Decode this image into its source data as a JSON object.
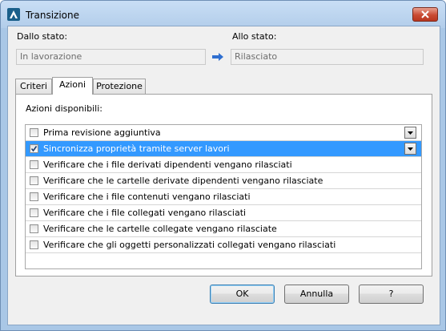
{
  "window": {
    "title": "Transizione",
    "app_icon": "app-logo-icon",
    "close_icon": "close-icon"
  },
  "from_state": {
    "label": "Dallo stato:",
    "value": "In lavorazione"
  },
  "to_state": {
    "label": "Allo stato:",
    "value": "Rilasciato"
  },
  "arrow_icon": "arrow-right-icon",
  "tabs": [
    {
      "label": "Criteri",
      "active": false
    },
    {
      "label": "Azioni",
      "active": true
    },
    {
      "label": "Protezione",
      "active": false
    }
  ],
  "actions": {
    "heading": "Azioni disponibili:",
    "items": [
      {
        "label": "Prima revisione aggiuntiva",
        "checked": false,
        "selected": false,
        "has_dropdown": true
      },
      {
        "label": "Sincronizza proprietà tramite server lavori",
        "checked": true,
        "selected": true,
        "has_dropdown": true
      },
      {
        "label": "Verificare che i file derivati dipendenti vengano rilasciati",
        "checked": false,
        "selected": false,
        "has_dropdown": false
      },
      {
        "label": "Verificare che le cartelle derivate dipendenti vengano rilasciate",
        "checked": false,
        "selected": false,
        "has_dropdown": false
      },
      {
        "label": "Verificare che i file contenuti vengano rilasciati",
        "checked": false,
        "selected": false,
        "has_dropdown": false
      },
      {
        "label": "Verificare che i file collegati vengano rilasciati",
        "checked": false,
        "selected": false,
        "has_dropdown": false
      },
      {
        "label": "Verificare che le cartelle collegate vengano rilasciate",
        "checked": false,
        "selected": false,
        "has_dropdown": false
      },
      {
        "label": "Verificare che gli oggetti personalizzati collegati vengano rilasciati",
        "checked": false,
        "selected": false,
        "has_dropdown": false
      }
    ]
  },
  "buttons": {
    "ok": "OK",
    "cancel": "Annulla",
    "help": "?"
  },
  "colors": {
    "selection": "#3399ff",
    "titlebar": "#b9d1ea",
    "arrow": "#2f6fd0"
  }
}
